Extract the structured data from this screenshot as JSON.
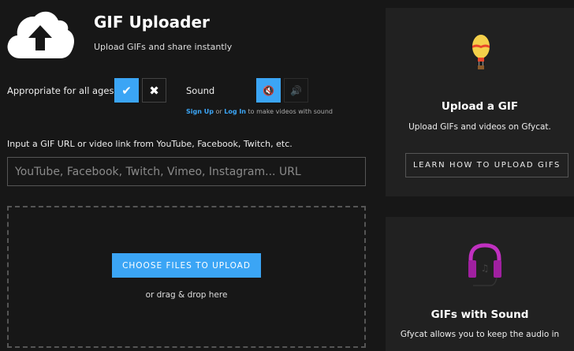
{
  "header": {
    "title": "GIF Uploader",
    "subtitle": "Upload GIFs and share instantly"
  },
  "options": {
    "ages_label": "Appropriate for all ages",
    "ages_yes": "✔",
    "ages_no": "✖",
    "sound_label": "Sound",
    "sound_off": "🔇",
    "sound_on": "🔊",
    "sign_up": "Sign Up",
    "or": " or ",
    "log_in": "Log In",
    "sound_hint": " to make videos with sound"
  },
  "url": {
    "label": "Input a GIF URL or video link from YouTube, Facebook, Twitch, etc.",
    "placeholder": "YouTube, Facebook, Twitch, Vimeo, Instagram... URL",
    "value": ""
  },
  "upload": {
    "button": "CHOOSE FILES TO UPLOAD",
    "drag_text": "or drag & drop here"
  },
  "sidebar": {
    "panel1": {
      "title": "Upload a GIF",
      "text": "Upload GIFs and videos on Gfycat.",
      "button": "LEARN HOW TO UPLOAD GIFS"
    },
    "panel2": {
      "title": "GIFs with Sound",
      "text": "Gfycat allows you to keep the audio in"
    }
  },
  "colors": {
    "accent": "#3ba5f5",
    "background": "#171717",
    "panel": "#212121"
  }
}
